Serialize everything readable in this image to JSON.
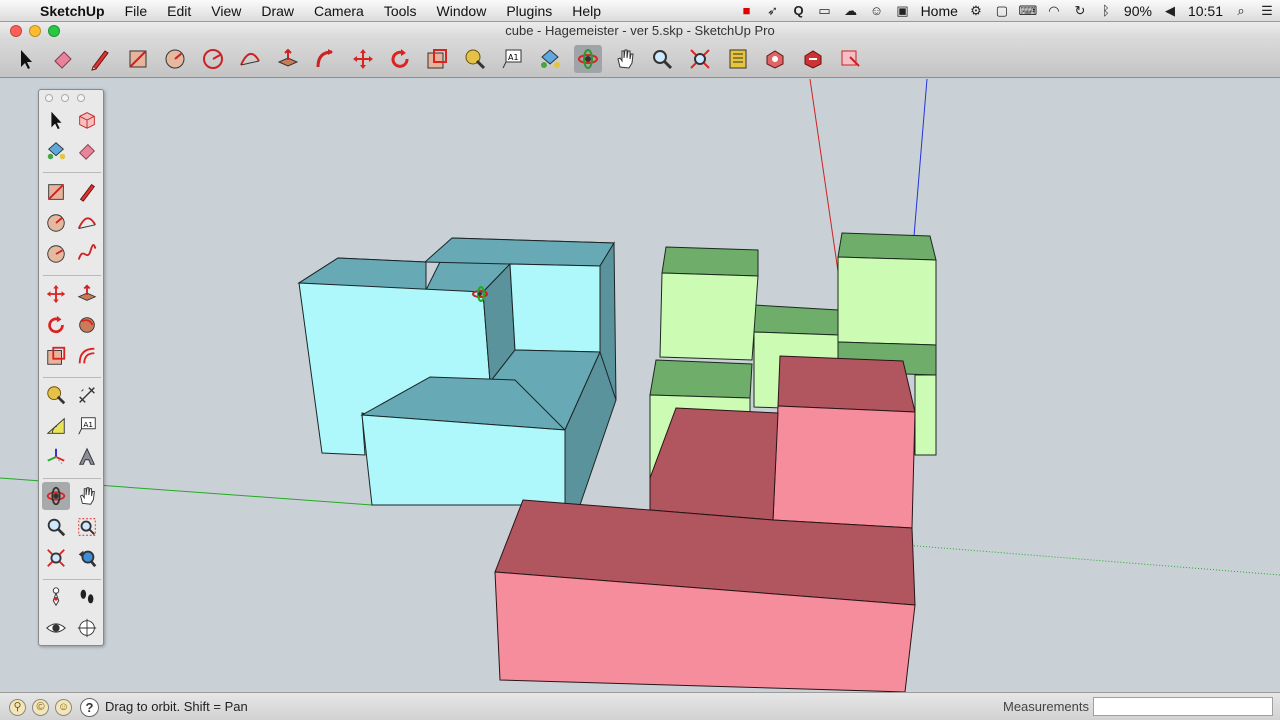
{
  "menubar": {
    "app_name": "SketchUp",
    "items": [
      "File",
      "Edit",
      "View",
      "Draw",
      "Camera",
      "Tools",
      "Window",
      "Plugins",
      "Help"
    ],
    "home_label": "Home",
    "battery": "90%",
    "clock": "10:51"
  },
  "window": {
    "title": "cube - Hagemeister - ver 5.skp - SketchUp Pro"
  },
  "toolbar": {
    "tools": [
      "select-tool",
      "eraser-tool",
      "line-tool",
      "rectangle-tool",
      "circle-tool",
      "arc-tool",
      "push-pull-tool",
      "follow-me-tool",
      "move-tool",
      "rotate-tool",
      "scale-tool",
      "tape-measure-tool",
      "text-tool",
      "paint-bucket-tool",
      "orbit-tool",
      "pan-tool",
      "zoom-tool",
      "zoom-extents-tool",
      "warehouse-tool",
      "get-models-tool",
      "share-model-tool"
    ],
    "active": "orbit-tool"
  },
  "palette": {
    "tools": [
      "select-tool",
      "make-component-tool",
      "paint-bucket-tool",
      "eraser-tool",
      "rectangle-tool",
      "line-tool",
      "circle-tool",
      "arc-tool",
      "polygon-tool",
      "freehand-tool",
      "move-tool",
      "push-pull-tool",
      "rotate-tool",
      "follow-me-tool",
      "scale-tool",
      "offset-tool",
      "tape-measure-tool",
      "dimension-tool",
      "protractor-tool",
      "text-tool",
      "axes-tool",
      "3d-text-tool",
      "orbit-tool",
      "pan-tool",
      "zoom-tool",
      "zoom-window-tool",
      "zoom-extents-tool",
      "previous-view-tool",
      "position-camera-tool",
      "walk-tool",
      "look-around-tool",
      "section-plane-tool"
    ],
    "active": "orbit-tool"
  },
  "statusbar": {
    "hint": "Drag to orbit.  Shift = Pan",
    "measurements_label": "Measurements",
    "measurements_value": ""
  },
  "colors": {
    "cyan_face": "#aef8fb",
    "cyan_top": "#67a9b4",
    "green_face": "#ccfbb4",
    "green_top": "#6eae6a",
    "red_face": "#f58d9c",
    "red_top": "#b1555f"
  }
}
